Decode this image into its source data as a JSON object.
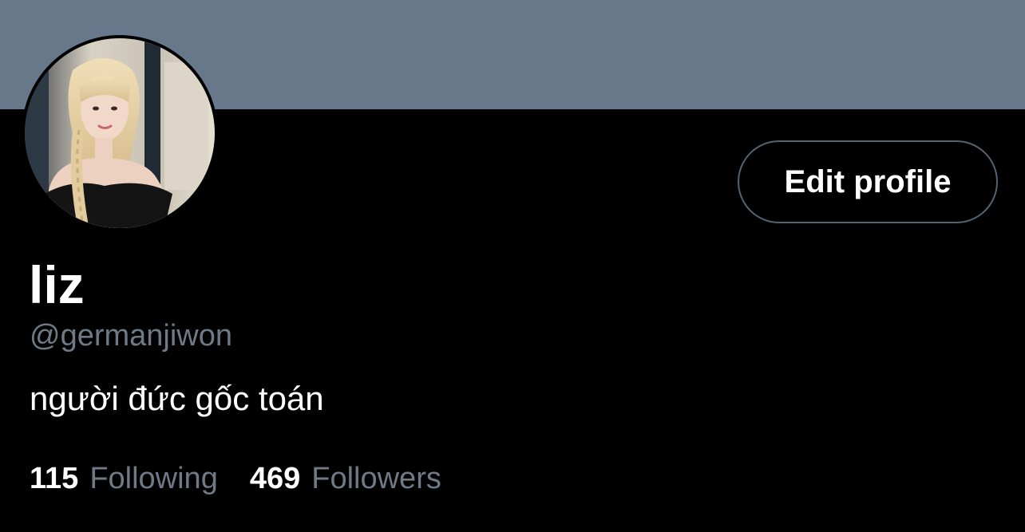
{
  "profile": {
    "display_name": "liz",
    "handle": "@germanjiwon",
    "bio": "người đức gốc toán",
    "edit_button_label": "Edit profile",
    "banner_color": "#66788a",
    "following": {
      "count": "115",
      "label": "Following"
    },
    "followers": {
      "count": "469",
      "label": "Followers"
    }
  }
}
